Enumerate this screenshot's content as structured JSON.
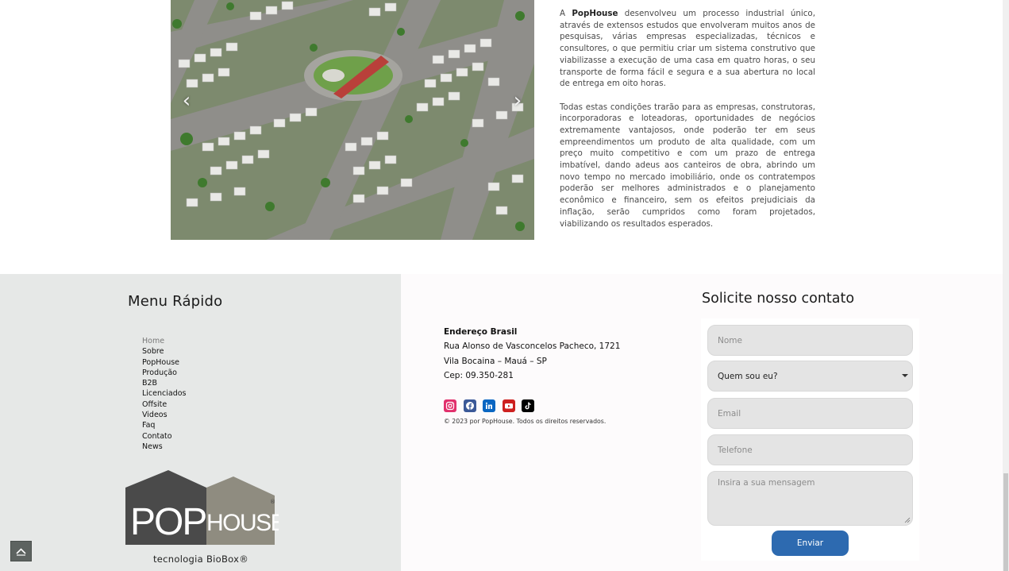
{
  "colors": {
    "footer_left_bg": "#e6e8e7",
    "footer_right_bg": "#fdfbfc",
    "button_blue": "#2d6ab0",
    "field_bg": "#e4e4e4"
  },
  "hero": {
    "prev_icon": "chevron-left-icon",
    "next_icon": "chevron-right-icon",
    "prev_glyph": "‹",
    "next_glyph": "›"
  },
  "intro": {
    "p1_prefix": "A ",
    "p1_brand": "PopHouse",
    "p1_rest": " desenvolveu um processo industrial único, através de extensos estudos que envolveram muitos anos de pesquisas, várias empresas especializadas, técnicos e consultores, o que permitiu criar um sistema construtivo que viabilizasse a execução de uma casa em quatro horas, o seu transporte de forma fácil e segura e a sua abertura no local de entrega em oito horas.",
    "p2": "Todas estas condições trarão para as empresas, construtoras, incorporadoras e loteadoras, oportunidades de negócios extremamente vantajosos, onde poderão ter em seus empreendimentos um produto de alta qualidade, com um preço muito competitivo e com um prazo de entrega imbatível, dando adeus aos canteiros de obra, abrindo um novo tempo no mercado imobiliário, onde os contratempos poderão ser melhores administrados e o planejamento econômico e financeiro, sem os efeitos prejudiciais da inflação, serão cumpridos como foram projetados, viabilizando os resultados esperados."
  },
  "menu": {
    "title": "Menu Rápido",
    "items": [
      "Home",
      "Sobre",
      "PopHouse",
      "Produção",
      "B2B",
      "Licenciados",
      "Offsite",
      "Videos",
      "Faq",
      "Contato",
      "News"
    ]
  },
  "logo": {
    "pop": "POP",
    "house": "HOUSE",
    "reg": "®",
    "tagline": "tecnologia BioBox®"
  },
  "address": {
    "heading": "Endereço Brasil",
    "line1": "Rua Alonso de Vasconcelos Pacheco, 1721",
    "line2": "Vila Bocaina – Mauá – SP",
    "line3": "Cep: 09.350-281"
  },
  "socials": [
    {
      "icon": "instagram-icon",
      "color": "#e1306c"
    },
    {
      "icon": "facebook-icon",
      "color": "#3b5998"
    },
    {
      "icon": "linkedin-icon",
      "color": "#0a66c2"
    },
    {
      "icon": "youtube-icon",
      "color": "#cd201f"
    },
    {
      "icon": "tiktok-icon",
      "color": "#000000"
    }
  ],
  "copyright": "© 2023 por PopHouse. Todos os direitos reservados.",
  "form": {
    "title": "Solicite nosso contato",
    "name_placeholder": "Nome",
    "role_selected": "Quem sou eu?",
    "email_placeholder": "Email",
    "phone_placeholder": "Telefone",
    "message_placeholder": "Insira a sua mensagem",
    "submit_label": "Enviar"
  },
  "back_to_top_icon": "arrow-up-icon"
}
